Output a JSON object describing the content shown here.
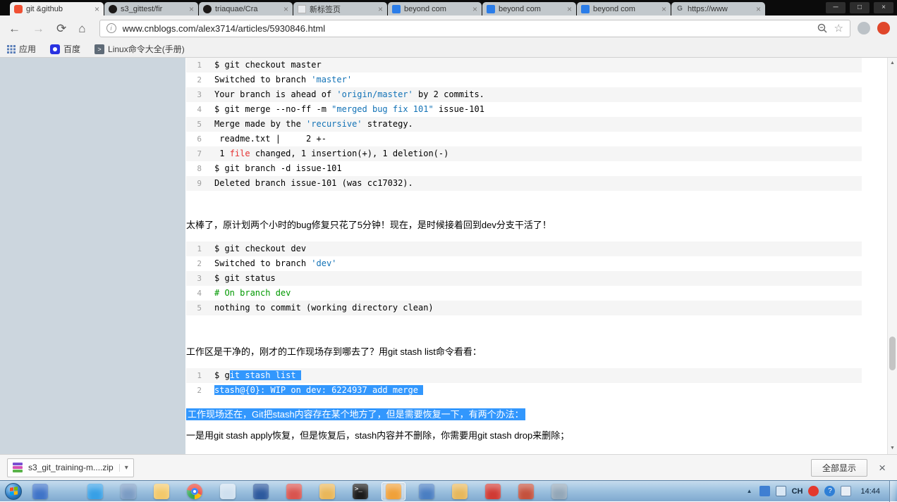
{
  "tabs": [
    {
      "label": "git &github",
      "icon": "git",
      "active": true
    },
    {
      "label": "s3_gittest/fir",
      "icon": "github",
      "active": false
    },
    {
      "label": "triaquae/Cra",
      "icon": "github",
      "active": false
    },
    {
      "label": "新标签页",
      "icon": "page",
      "active": false
    },
    {
      "label": "beyond com",
      "icon": "blue",
      "active": false
    },
    {
      "label": "beyond com",
      "icon": "blue",
      "active": false
    },
    {
      "label": "beyond com",
      "icon": "blue",
      "active": false
    },
    {
      "label": "https://www",
      "icon": "google",
      "active": false
    }
  ],
  "nav": {
    "url": "www.cnblogs.com/alex3714/articles/5930846.html"
  },
  "bookmarks": {
    "items": [
      "应用",
      "百度",
      "Linux命令大全(手册)"
    ]
  },
  "article": {
    "paragraph1": "太棒了，原计划两个小时的bug修复只花了5分钟！现在，是时候接着回到dev分支干活了！",
    "paragraph2": "工作区是干净的，刚才的工作现场存到哪去了？用git stash list命令看看：",
    "highlighted_paragraph": "工作现场还在，Git把stash内容存在某个地方了，但是需要恢复一下，有两个办法：",
    "paragraph3": "一是用git stash apply恢复，但是恢复后，stash内容并不删除，你需要用git stash drop来删除；",
    "code_blocks": [
      {
        "lines": [
          [
            {
              "t": "$ git checkout master"
            }
          ],
          [
            {
              "t": "Switched to branch "
            },
            {
              "t": "'master'",
              "c": "str"
            }
          ],
          [
            {
              "t": "Your branch is ahead of "
            },
            {
              "t": "'origin/master'",
              "c": "str"
            },
            {
              "t": " by 2 commits."
            }
          ],
          [
            {
              "t": "$ git merge --no-ff -m "
            },
            {
              "t": "\"merged bug fix 101\"",
              "c": "str"
            },
            {
              "t": " issue-101"
            }
          ],
          [
            {
              "t": "Merge made by the "
            },
            {
              "t": "'recursive'",
              "c": "str"
            },
            {
              "t": " strategy."
            }
          ],
          [
            {
              "t": " readme.txt |     2 +-"
            }
          ],
          [
            {
              "t": " 1 "
            },
            {
              "t": "file",
              "c": "red"
            },
            {
              "t": " changed, 1 insertion(+), 1 deletion(-)"
            }
          ],
          [
            {
              "t": "$ git branch -d issue-101"
            }
          ],
          [
            {
              "t": "Deleted branch issue-101 (was cc17032)."
            }
          ]
        ]
      },
      {
        "lines": [
          [
            {
              "t": "$ git checkout dev"
            }
          ],
          [
            {
              "t": "Switched to branch "
            },
            {
              "t": "'dev'",
              "c": "str"
            }
          ],
          [
            {
              "t": "$ git status"
            }
          ],
          [
            {
              "t": "# On branch dev",
              "c": "green"
            }
          ],
          [
            {
              "t": "nothing to commit (working directory clean)"
            }
          ]
        ]
      },
      {
        "lines": [
          [
            {
              "t": "$ g"
            },
            {
              "t": "it stash list ",
              "c": "sel"
            }
          ],
          [
            {
              "t": "stash@{0}: WIP on dev: 6224937 add merge ",
              "c": "sel"
            }
          ]
        ]
      }
    ]
  },
  "download_bar": {
    "file_name": "s3_git_training-m....zip",
    "show_all": "全部显示"
  },
  "taskbar": {
    "lang": "CH",
    "time": "14:44",
    "icons": [
      {
        "name": "internet-explorer-icon",
        "color": "#3f74c8",
        "gapAfter": true
      },
      {
        "name": "messenger-icon",
        "color": "#37a0e6"
      },
      {
        "name": "save-icon",
        "color": "#7b9cc4"
      },
      {
        "name": "explorer-folder-icon",
        "color": "#f3c96b"
      },
      {
        "name": "chrome-icon",
        "color": "#4285f4"
      },
      {
        "name": "notepad-icon",
        "color": "#cfe0ef"
      },
      {
        "name": "word-icon",
        "color": "#2d5a9e"
      },
      {
        "name": "media-player-icon",
        "color": "#d9544f"
      },
      {
        "name": "folder-settings-icon",
        "color": "#e9b75a"
      },
      {
        "name": "cmd-icon",
        "color": "#1b1b1b"
      },
      {
        "name": "ftp-client-icon",
        "color": "#f0a13a",
        "active": true
      },
      {
        "name": "virtualbox-icon",
        "color": "#4a7ec2"
      },
      {
        "name": "folder-share-icon",
        "color": "#e7b85c"
      },
      {
        "name": "netease-music-icon",
        "color": "#d03a34"
      },
      {
        "name": "browser2-icon",
        "color": "#c4513d"
      },
      {
        "name": "remote-desktop-icon",
        "color": "#93a7b8"
      }
    ]
  }
}
